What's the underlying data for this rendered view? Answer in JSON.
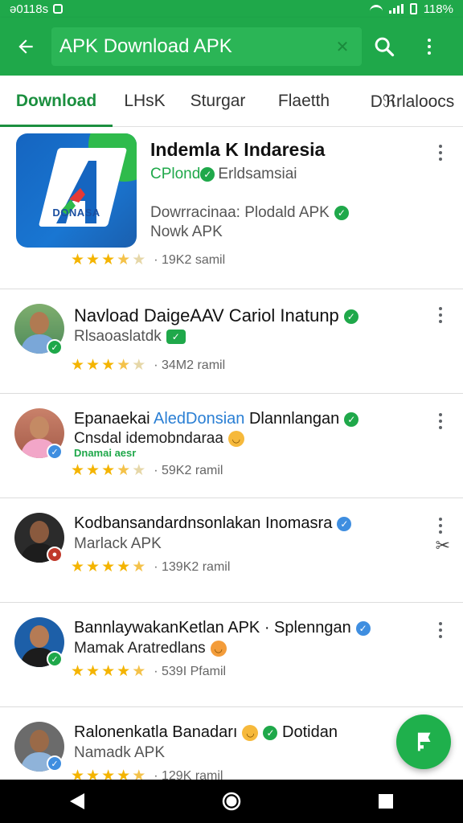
{
  "status_bar": {
    "time": "ə0118s",
    "battery": "118%"
  },
  "appbar": {
    "search_text": "APK Download APK",
    "clear_symbol": "✕"
  },
  "tabs": [
    {
      "label": "Download",
      "active": true
    },
    {
      "label": "LHsK",
      "active": false
    },
    {
      "label": "Sturgar",
      "active": false
    },
    {
      "label": "Flaetth",
      "active": false
    },
    {
      "label": "Dℜrlaloocs",
      "active": false
    }
  ],
  "items": [
    {
      "title": "Indemla K Indaresia",
      "subtitle_green": "CPlond",
      "subtitle_rest": "Erldsamsiai",
      "line3": "Dowrracinaa: Plodald APK",
      "line4": "Nowk APK",
      "stars": [
        1,
        1,
        1,
        0.5,
        0
      ],
      "count": "· 19K2 samil",
      "icon_label": "DONASA"
    },
    {
      "title": "Navload DaigeAAV Cariol Inatunp",
      "subtitle": "Rlsaoaslatdk",
      "stars": [
        1,
        1,
        1,
        0.5,
        0
      ],
      "count": "· 34M2 ramil"
    },
    {
      "title_a": "Epanaekai",
      "title_b": "AledDonsian",
      "title_c": "Dlannlangan",
      "subtitle": "Cnsdal idemobndaraa",
      "tag": "Dnamai aesr",
      "stars": [
        1,
        1,
        1,
        0.5,
        0
      ],
      "count": "· 59K2 ramil"
    },
    {
      "title": "Kodbansandardnsonlakan Inomasra",
      "subtitle": "Marlack APK",
      "stars": [
        1,
        1,
        1,
        1,
        0.5
      ],
      "count": "· 139K2 ramil"
    },
    {
      "title": "BannlaywakanKetlan APK · Splenngan",
      "subtitle": "Mamak Aratredlans",
      "stars": [
        1,
        1,
        1,
        1,
        0.5
      ],
      "count": "· 539I Pfamil"
    },
    {
      "title": "Ralonenkatla Banadarı",
      "title_tail": "Dotidan",
      "subtitle": "Namadk APK",
      "stars": [
        1,
        1,
        1,
        1,
        0.5
      ],
      "count": "· 129K ramil"
    }
  ],
  "colors": {
    "primary": "#1fa84a",
    "accent": "#1b8f3f",
    "star": "#f4b400"
  }
}
